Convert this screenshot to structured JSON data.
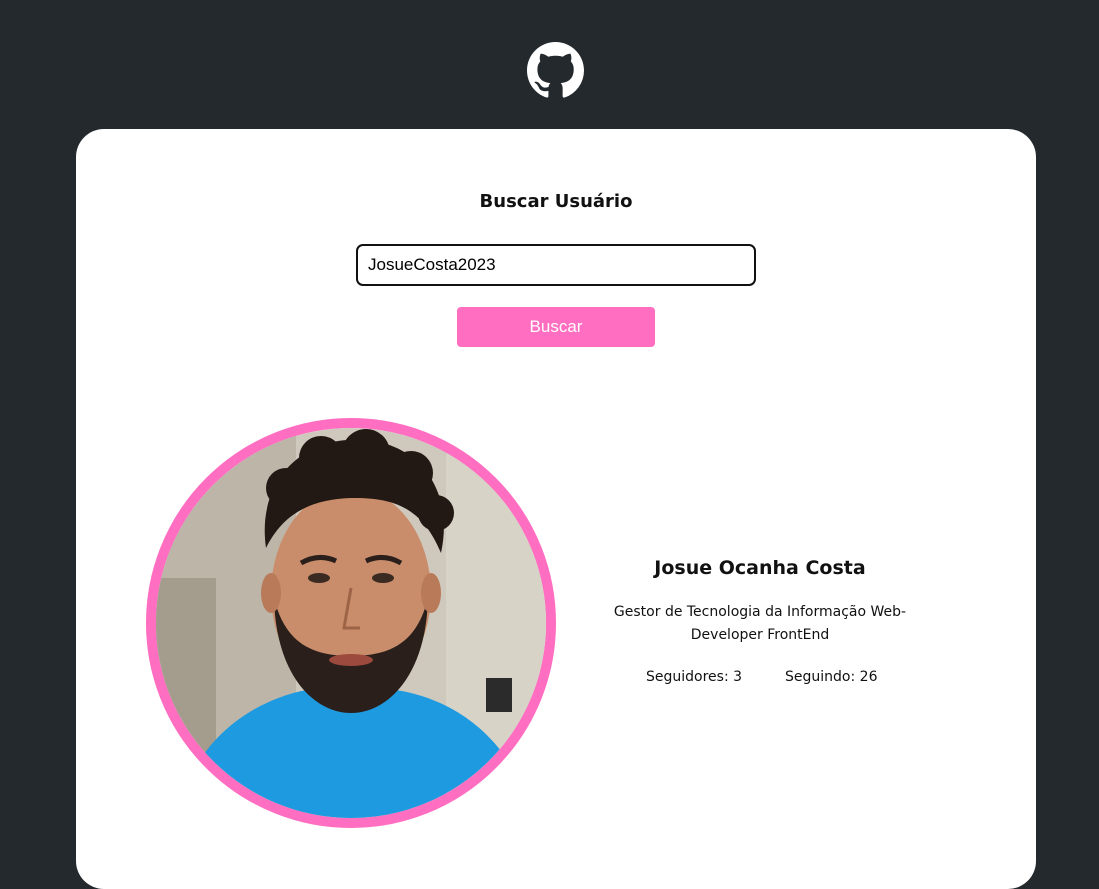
{
  "header": {
    "logo_icon": "github-octocat-icon"
  },
  "search": {
    "title": "Buscar Usuário",
    "input_value": "JosueCosta2023",
    "button_label": "Buscar"
  },
  "profile": {
    "avatar": "user-avatar-photo",
    "name": "Josue Ocanha Costa",
    "bio_line1": "Gestor de Tecnologia da Informação Web-",
    "bio_line2": "Developer FrontEnd",
    "followers_label": "Seguidores:",
    "followers_count": "3",
    "following_label": "Seguindo:",
    "following_count": "26"
  },
  "colors": {
    "background": "#24292e",
    "card": "#ffffff",
    "accent": "#ff6ec1"
  }
}
